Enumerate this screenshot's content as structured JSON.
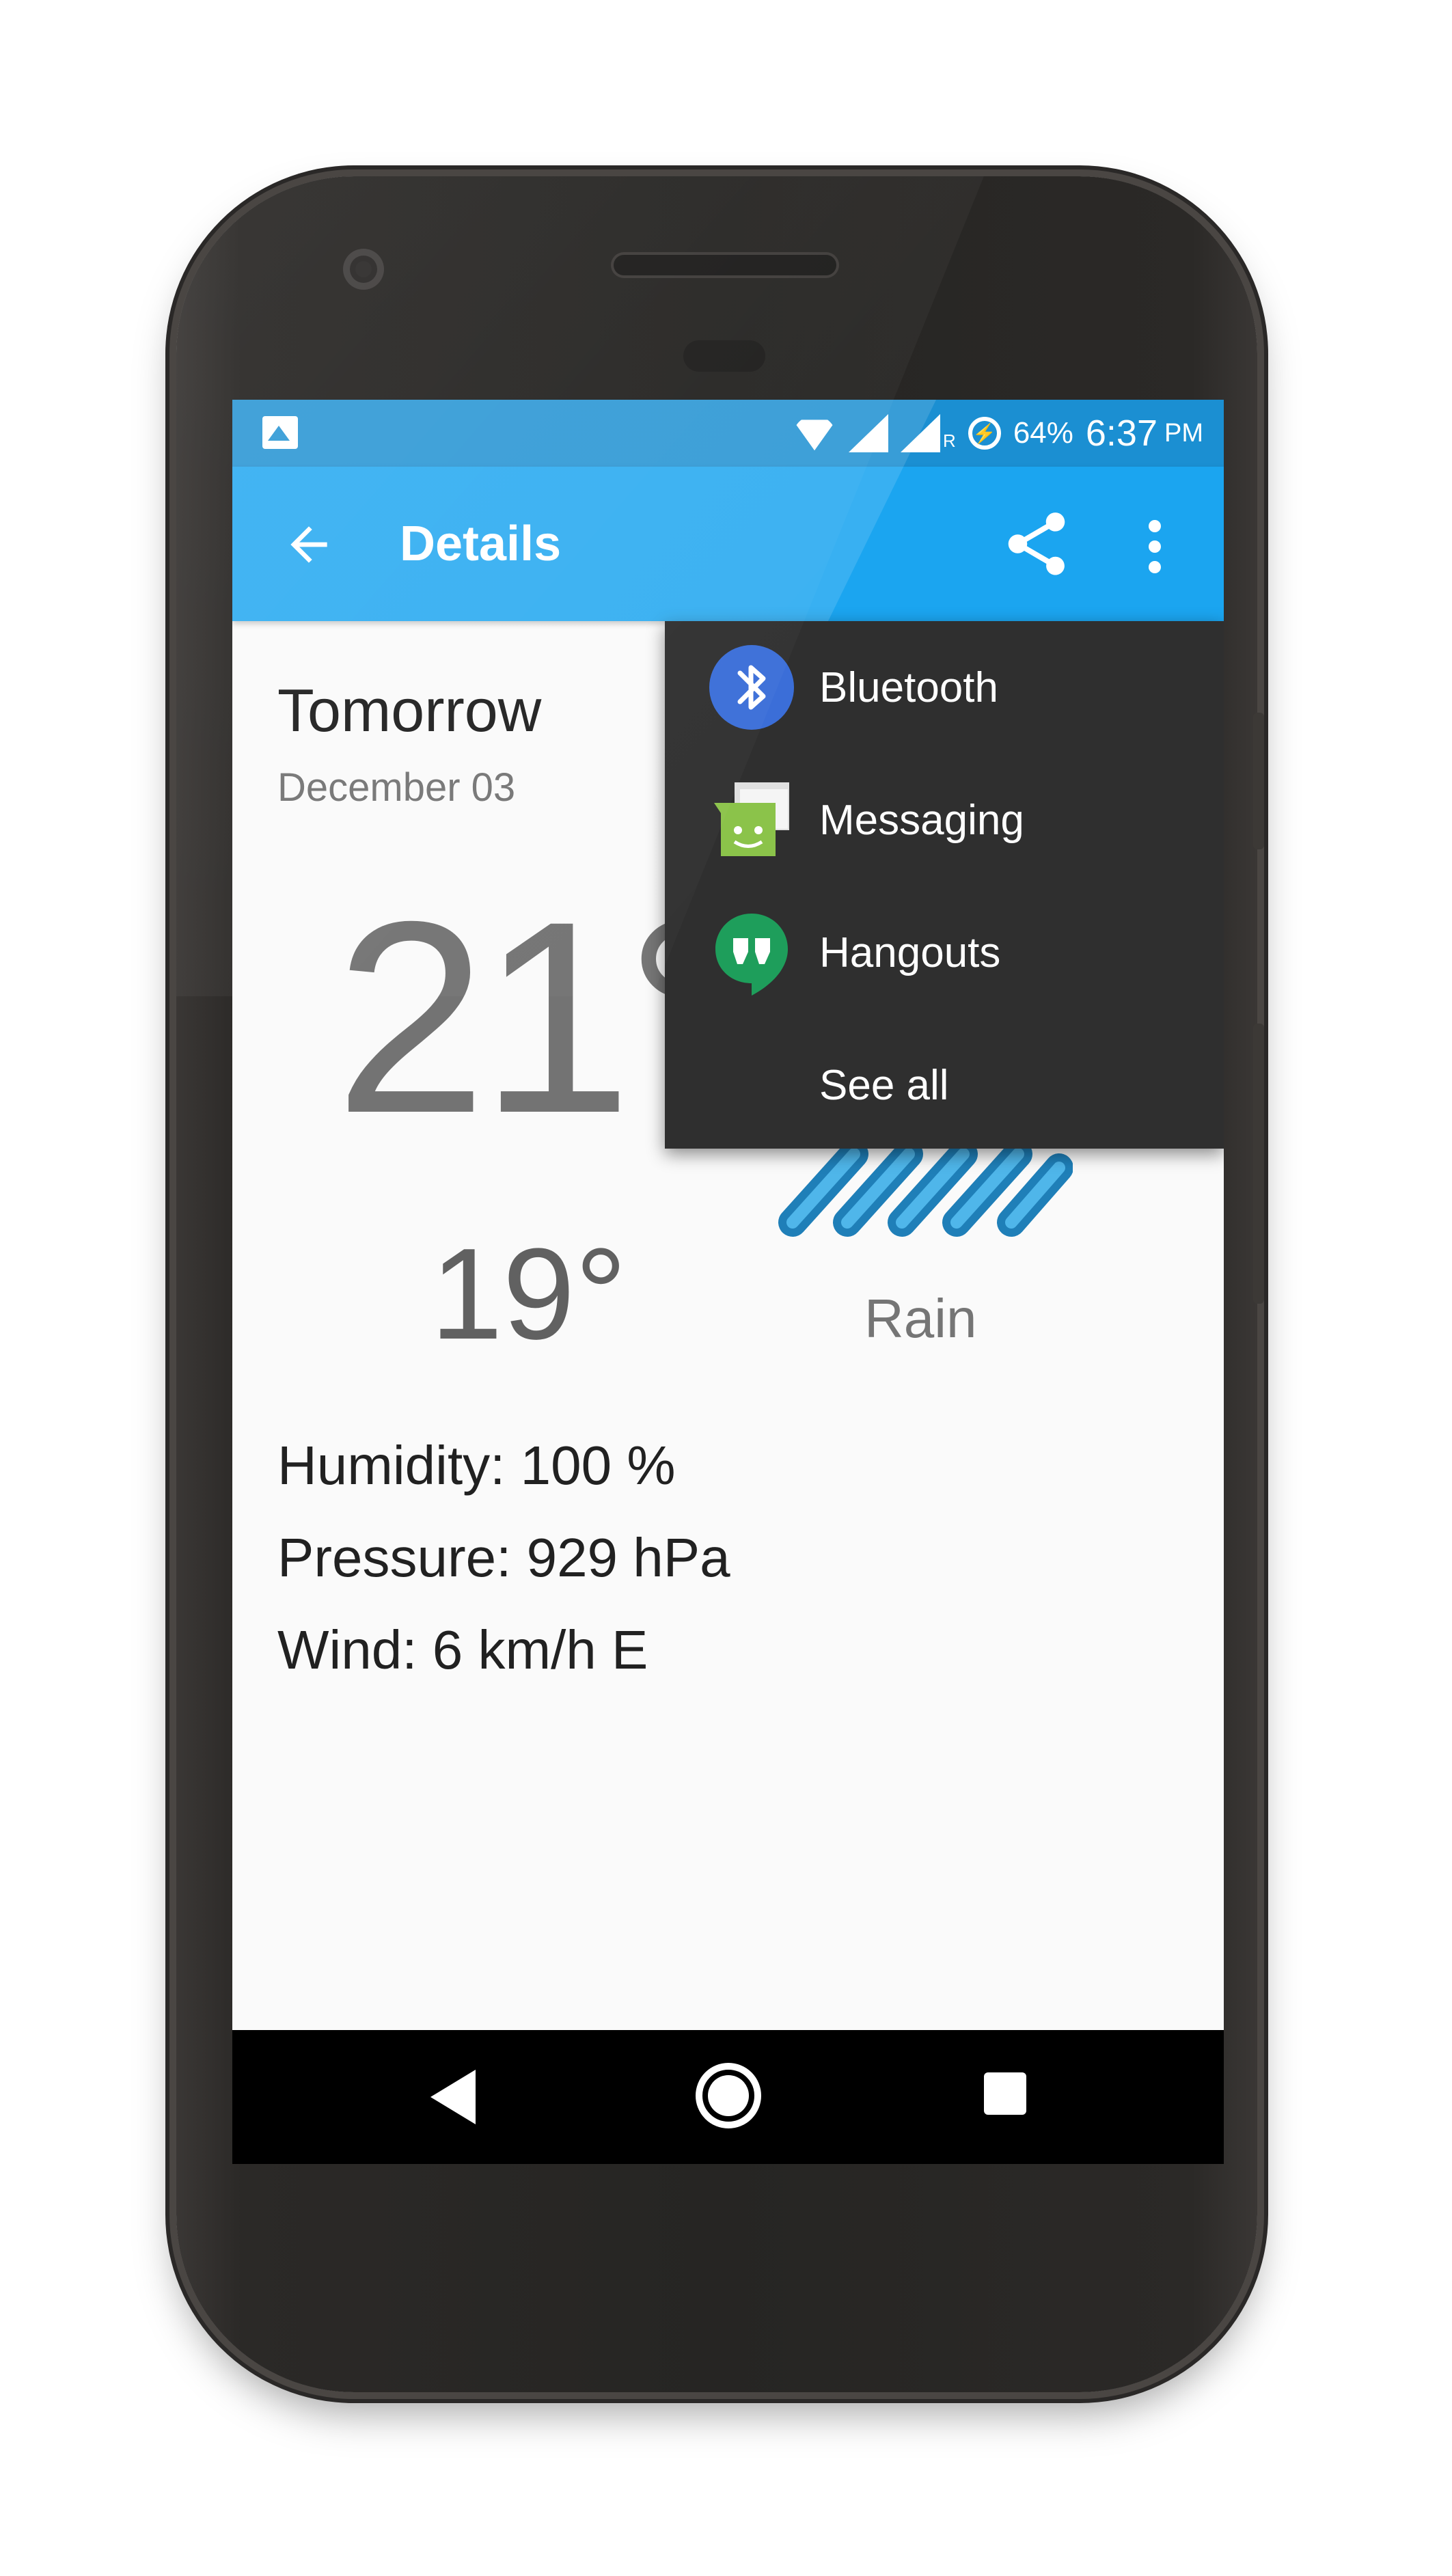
{
  "status_bar": {
    "battery_percent": "64%",
    "time": "6:37",
    "ampm": "PM",
    "roaming_mark": "R",
    "icons": [
      "image-icon",
      "wifi-icon",
      "signal-icon",
      "signal-roaming-icon",
      "battery-charging-icon"
    ]
  },
  "app_bar": {
    "title": "Details",
    "back_icon": "arrow-back-icon",
    "share_icon": "share-icon",
    "more_icon": "more-vert-icon"
  },
  "forecast": {
    "day": "Tomorrow",
    "date": "December 03",
    "high": "21°",
    "low": "19°",
    "condition": "Rain",
    "humidity": "Humidity: 100 %",
    "pressure": "Pressure: 929 hPa",
    "wind": "Wind: 6 km/h E"
  },
  "share_menu": {
    "items": [
      {
        "label": "Bluetooth",
        "icon": "bluetooth-icon"
      },
      {
        "label": "Messaging",
        "icon": "messaging-icon"
      },
      {
        "label": "Hangouts",
        "icon": "hangouts-icon"
      },
      {
        "label": "See all",
        "icon": ""
      }
    ]
  },
  "colors": {
    "status_bar": "#1b8fd2",
    "app_bar": "#1ba5f0",
    "menu_bg": "#2f2f2f",
    "rain": "#2a9ad8"
  }
}
